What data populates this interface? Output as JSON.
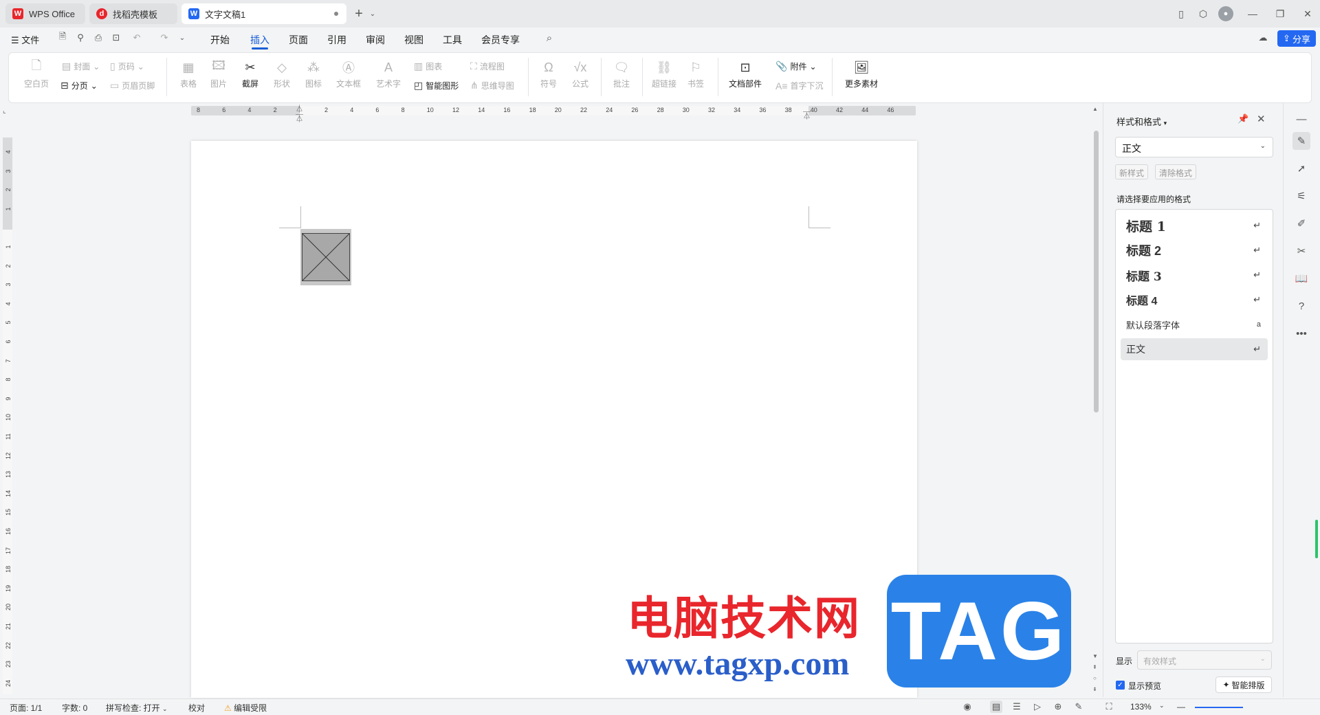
{
  "tabs": [
    {
      "label": "WPS Office",
      "icon": "wps-logo-icon",
      "color": "#e8262c"
    },
    {
      "label": "找稻壳模板",
      "icon": "docer-logo-icon",
      "color": "#e8262c"
    },
    {
      "label": "文字文稿1",
      "icon": "writer-logo-icon",
      "color": "#2468f2"
    }
  ],
  "menubar": {
    "file_label": "文件",
    "items": [
      "开始",
      "插入",
      "页面",
      "引用",
      "审阅",
      "视图",
      "工具",
      "会员专享"
    ],
    "active": "插入",
    "share_label": "分享"
  },
  "ribbon": {
    "blank_page": "空白页",
    "cover": "封面",
    "page_break": "分页",
    "page_number": "页码",
    "header_footer": "页眉页脚",
    "table": "表格",
    "picture": "图片",
    "screenshot": "截屏",
    "shape": "形状",
    "icon": "图标",
    "textbox": "文本框",
    "wordart": "艺术字",
    "chart": "图表",
    "smart_graphic": "智能图形",
    "flowchart": "流程图",
    "mindmap": "思维导图",
    "symbol": "符号",
    "formula": "公式",
    "comment": "批注",
    "hyperlink": "超链接",
    "bookmark": "书签",
    "doc_parts": "文档部件",
    "attachment": "附件",
    "drop_cap": "首字下沉",
    "more_material": "更多素材"
  },
  "hruler_labels": [
    "8",
    "6",
    "4",
    "2",
    "",
    "2",
    "4",
    "6",
    "8",
    "10",
    "12",
    "14",
    "16",
    "18",
    "20",
    "22",
    "24",
    "26",
    "28",
    "30",
    "32",
    "34",
    "36",
    "38",
    "40",
    "42",
    "44",
    "46"
  ],
  "vruler_labels": [
    "4",
    "3",
    "2",
    "1",
    "",
    "1",
    "2",
    "3",
    "4",
    "5",
    "6",
    "7",
    "8",
    "9",
    "10",
    "11",
    "12",
    "13",
    "14",
    "15",
    "16",
    "17",
    "18",
    "19",
    "20",
    "21",
    "22",
    "23",
    "24"
  ],
  "watermark": {
    "cn": "电脑技术网",
    "url": "www.tagxp.com",
    "tag": "TAG"
  },
  "panel": {
    "title": "样式和格式",
    "current_style": "正文",
    "new_style": "新样式",
    "clear_format": "清除格式",
    "apply_label": "请选择要应用的格式",
    "styles": [
      {
        "label": "标题  1",
        "level": "h1"
      },
      {
        "label": "标题  2",
        "level": "h2"
      },
      {
        "label": "标题  3",
        "level": "h3"
      },
      {
        "label": "标题  4",
        "level": "h4"
      },
      {
        "label": "默认段落字体",
        "level": "char"
      },
      {
        "label": "正文",
        "level": "body"
      }
    ],
    "show_label": "显示",
    "show_value": "有效样式",
    "preview_label": "显示预览",
    "smart_layout": "智能排版"
  },
  "status": {
    "page": "页面: 1/1",
    "words": "字数: 0",
    "spellcheck": "拼写检查: 打开",
    "proofread": "校对",
    "edit_restrict": "编辑受限",
    "zoom": "133%"
  },
  "colors": {
    "accent": "#2468f2",
    "brand_red": "#e8262c"
  }
}
